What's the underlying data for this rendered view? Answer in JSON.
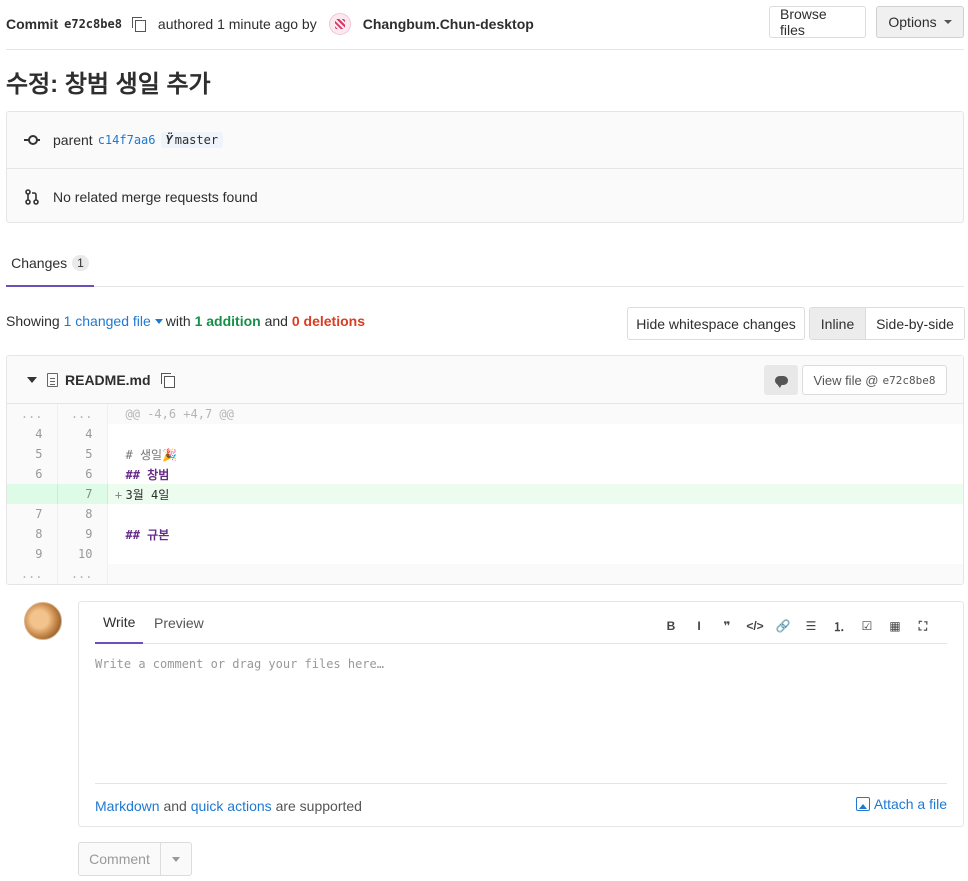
{
  "header": {
    "commit_label": "Commit",
    "sha": "e72c8be8",
    "authored_text": "authored 1 minute ago by",
    "author": "Changbum.Chun-desktop",
    "browse_label": "Browse files",
    "options_label": "Options"
  },
  "title": "수정: 창범 생일 추가",
  "info": {
    "parent_label": "parent",
    "parent_sha": "c14f7aa6",
    "branch": "master",
    "mr_text": "No related merge requests found"
  },
  "tabs": {
    "changes_label": "Changes",
    "changes_count": "1"
  },
  "summary": {
    "showing": "Showing",
    "changed_file": "1 changed file",
    "with": "with",
    "additions": "1 addition",
    "and": "and",
    "deletions": "0 deletions"
  },
  "view_buttons": {
    "hide_whitespace": "Hide whitespace changes",
    "inline": "Inline",
    "side_by_side": "Side-by-side"
  },
  "file": {
    "name": "README.md",
    "view_file_label": "View file @",
    "view_file_sha": "e72c8be8",
    "lines": [
      {
        "type": "match",
        "old": "...",
        "new": "...",
        "text": "@@ -4,6 +4,7 @@"
      },
      {
        "type": "ctx",
        "old": "4",
        "new": "4",
        "text": ""
      },
      {
        "type": "ctx",
        "old": "5",
        "new": "5",
        "text": "# 생일🎉"
      },
      {
        "type": "ctx",
        "old": "6",
        "new": "6",
        "text": "## 창범"
      },
      {
        "type": "add",
        "old": "",
        "new": "7",
        "text": "3월 4일"
      },
      {
        "type": "ctx",
        "old": "7",
        "new": "8",
        "text": ""
      },
      {
        "type": "ctx",
        "old": "8",
        "new": "9",
        "text": "## 규본"
      },
      {
        "type": "ctx",
        "old": "9",
        "new": "10",
        "text": ""
      },
      {
        "type": "match",
        "old": "...",
        "new": "...",
        "text": ""
      }
    ]
  },
  "editor": {
    "write_tab": "Write",
    "preview_tab": "Preview",
    "placeholder": "Write a comment or drag your files here…",
    "markdown_link": "Markdown",
    "and_text": "and",
    "quick_actions_link": "quick actions",
    "supported_text": "are supported",
    "attach_label": "Attach a file",
    "toolbar": [
      "B",
      "I",
      "❞",
      "</>",
      "🔗",
      "☰",
      "⒈",
      "☑",
      "▦",
      "⛶"
    ]
  },
  "submit": {
    "comment_label": "Comment"
  },
  "colors": {
    "accent": "#6b4fbb",
    "link": "#1f78d1",
    "addition": "#168f48",
    "deletion": "#db3b21"
  }
}
